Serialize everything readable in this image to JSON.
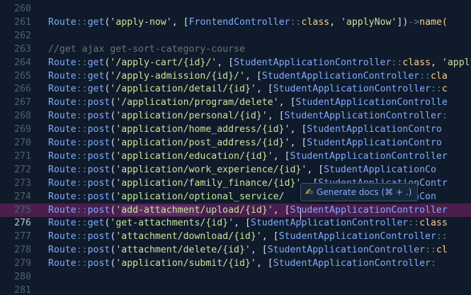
{
  "editor": {
    "lines": [
      {
        "num": "260",
        "tokens": []
      },
      {
        "num": "261",
        "tokens": [
          {
            "t": "Route",
            "c": "t-route"
          },
          {
            "t": "::",
            "c": "t-op"
          },
          {
            "t": "get",
            "c": "t-fn"
          },
          {
            "t": "(",
            "c": "t-brk"
          },
          {
            "t": "'apply-now'",
            "c": "t-str"
          },
          {
            "t": ", ",
            "c": "t-brk"
          },
          {
            "t": "[",
            "c": "t-brk"
          },
          {
            "t": "FrontendController",
            "c": "t-cls"
          },
          {
            "t": "::",
            "c": "t-op"
          },
          {
            "t": "class",
            "c": "t-kw"
          },
          {
            "t": ", ",
            "c": "t-brk"
          },
          {
            "t": "'applyNow'",
            "c": "t-str"
          },
          {
            "t": "])",
            "c": "t-brk"
          },
          {
            "t": "->",
            "c": "t-op"
          },
          {
            "t": "name(",
            "c": "t-kw"
          }
        ]
      },
      {
        "num": "262",
        "tokens": []
      },
      {
        "num": "263",
        "tokens": [
          {
            "t": "//get ajax get-sort-category-course",
            "c": "t-cmt"
          }
        ]
      },
      {
        "num": "264",
        "tokens": [
          {
            "t": "Route",
            "c": "t-route"
          },
          {
            "t": "::",
            "c": "t-op"
          },
          {
            "t": "get",
            "c": "t-fn"
          },
          {
            "t": "(",
            "c": "t-brk"
          },
          {
            "t": "'/apply-cart/{id}/'",
            "c": "t-str"
          },
          {
            "t": ", ",
            "c": "t-brk"
          },
          {
            "t": "[",
            "c": "t-brk"
          },
          {
            "t": "StudentApplicationController",
            "c": "t-cls"
          },
          {
            "t": "::",
            "c": "t-op"
          },
          {
            "t": "class",
            "c": "t-kw"
          },
          {
            "t": ", ",
            "c": "t-brk"
          },
          {
            "t": "'apply",
            "c": "t-str"
          }
        ]
      },
      {
        "num": "265",
        "tokens": [
          {
            "t": "Route",
            "c": "t-route"
          },
          {
            "t": "::",
            "c": "t-op"
          },
          {
            "t": "get",
            "c": "t-fn"
          },
          {
            "t": "(",
            "c": "t-brk"
          },
          {
            "t": "'/apply-admission/{id}/'",
            "c": "t-str"
          },
          {
            "t": ", ",
            "c": "t-brk"
          },
          {
            "t": "[",
            "c": "t-brk"
          },
          {
            "t": "StudentApplicationController",
            "c": "t-cls"
          },
          {
            "t": "::",
            "c": "t-op"
          },
          {
            "t": "cla",
            "c": "t-kw"
          }
        ]
      },
      {
        "num": "266",
        "tokens": [
          {
            "t": "Route",
            "c": "t-route"
          },
          {
            "t": "::",
            "c": "t-op"
          },
          {
            "t": "get",
            "c": "t-fn"
          },
          {
            "t": "(",
            "c": "t-brk"
          },
          {
            "t": "'/application/detail/{id}'",
            "c": "t-str"
          },
          {
            "t": ", ",
            "c": "t-brk"
          },
          {
            "t": "[",
            "c": "t-brk"
          },
          {
            "t": "StudentApplicationController",
            "c": "t-cls"
          },
          {
            "t": "::",
            "c": "t-op"
          },
          {
            "t": "c",
            "c": "t-kw"
          }
        ]
      },
      {
        "num": "267",
        "tokens": [
          {
            "t": "Route",
            "c": "t-route"
          },
          {
            "t": "::",
            "c": "t-op"
          },
          {
            "t": "post",
            "c": "t-fn"
          },
          {
            "t": "(",
            "c": "t-brk"
          },
          {
            "t": "'/application/program/delete'",
            "c": "t-str"
          },
          {
            "t": ", ",
            "c": "t-brk"
          },
          {
            "t": "[",
            "c": "t-brk"
          },
          {
            "t": "StudentApplicationControlle",
            "c": "t-cls"
          }
        ]
      },
      {
        "num": "268",
        "tokens": [
          {
            "t": "Route",
            "c": "t-route"
          },
          {
            "t": "::",
            "c": "t-op"
          },
          {
            "t": "post",
            "c": "t-fn"
          },
          {
            "t": "(",
            "c": "t-brk"
          },
          {
            "t": "'application/personal/{id}'",
            "c": "t-str"
          },
          {
            "t": ", ",
            "c": "t-brk"
          },
          {
            "t": "[",
            "c": "t-brk"
          },
          {
            "t": "StudentApplicationController",
            "c": "t-cls"
          },
          {
            "t": ":",
            "c": "t-op"
          }
        ]
      },
      {
        "num": "269",
        "tokens": [
          {
            "t": "Route",
            "c": "t-route"
          },
          {
            "t": "::",
            "c": "t-op"
          },
          {
            "t": "post",
            "c": "t-fn"
          },
          {
            "t": "(",
            "c": "t-brk"
          },
          {
            "t": "'application/home_address/{id}'",
            "c": "t-str"
          },
          {
            "t": ", ",
            "c": "t-brk"
          },
          {
            "t": "[",
            "c": "t-brk"
          },
          {
            "t": "StudentApplicationContro",
            "c": "t-cls"
          }
        ]
      },
      {
        "num": "270",
        "tokens": [
          {
            "t": "Route",
            "c": "t-route"
          },
          {
            "t": "::",
            "c": "t-op"
          },
          {
            "t": "post",
            "c": "t-fn"
          },
          {
            "t": "(",
            "c": "t-brk"
          },
          {
            "t": "'application/post_address/{id}'",
            "c": "t-str"
          },
          {
            "t": ", ",
            "c": "t-brk"
          },
          {
            "t": "[",
            "c": "t-brk"
          },
          {
            "t": "StudentApplicationContro",
            "c": "t-cls"
          }
        ]
      },
      {
        "num": "271",
        "tokens": [
          {
            "t": "Route",
            "c": "t-route"
          },
          {
            "t": "::",
            "c": "t-op"
          },
          {
            "t": "post",
            "c": "t-fn"
          },
          {
            "t": "(",
            "c": "t-brk"
          },
          {
            "t": "'application/education/{id}'",
            "c": "t-str"
          },
          {
            "t": ", ",
            "c": "t-brk"
          },
          {
            "t": "[",
            "c": "t-brk"
          },
          {
            "t": "StudentApplicationController",
            "c": "t-cls"
          }
        ]
      },
      {
        "num": "272",
        "tokens": [
          {
            "t": "Route",
            "c": "t-route"
          },
          {
            "t": "::",
            "c": "t-op"
          },
          {
            "t": "post",
            "c": "t-fn"
          },
          {
            "t": "(",
            "c": "t-brk"
          },
          {
            "t": "'application/work_experience/{id}'",
            "c": "t-str"
          },
          {
            "t": ", ",
            "c": "t-brk"
          },
          {
            "t": "[",
            "c": "t-brk"
          },
          {
            "t": "StudentApplicationCo",
            "c": "t-cls"
          }
        ]
      },
      {
        "num": "273",
        "tokens": [
          {
            "t": "Route",
            "c": "t-route"
          },
          {
            "t": "::",
            "c": "t-op"
          },
          {
            "t": "post",
            "c": "t-fn"
          },
          {
            "t": "(",
            "c": "t-brk"
          },
          {
            "t": "'application/family_finance/{id}'",
            "c": "t-str"
          },
          {
            "t": ", ",
            "c": "t-brk"
          },
          {
            "t": "[",
            "c": "t-brk"
          },
          {
            "t": "StudentApplicationContr",
            "c": "t-cls"
          }
        ]
      },
      {
        "num": "274",
        "tokens": [
          {
            "t": "Route",
            "c": "t-route"
          },
          {
            "t": "::",
            "c": "t-op"
          },
          {
            "t": "post",
            "c": "t-fn"
          },
          {
            "t": "(",
            "c": "t-brk"
          },
          {
            "t": "'application/optional_service/",
            "c": "t-str"
          },
          {
            "t": "                  ",
            "c": "t-brk"
          },
          {
            "t": "cationCon",
            "c": "t-cls"
          }
        ]
      },
      {
        "num": "275",
        "hl": true,
        "tokens": [
          {
            "t": "Route",
            "c": "t-route"
          },
          {
            "t": "::",
            "c": "t-op"
          },
          {
            "t": "post",
            "c": "t-fn"
          },
          {
            "t": "(",
            "c": "t-brk"
          },
          {
            "t": "'add-attachment/upload/{id}'",
            "c": "t-str"
          },
          {
            "t": ", ",
            "c": "t-brk"
          },
          {
            "t": "[",
            "c": "t-brk"
          },
          {
            "t": "StudentApplicationController",
            "c": "t-cls"
          }
        ]
      },
      {
        "num": "276",
        "current": true,
        "tokens": [
          {
            "t": "Route",
            "c": "t-route"
          },
          {
            "t": "::",
            "c": "t-op"
          },
          {
            "t": "get",
            "c": "t-fn"
          },
          {
            "t": "(",
            "c": "t-brk"
          },
          {
            "t": "'get-attachments/{id}'",
            "c": "t-str"
          },
          {
            "t": ", ",
            "c": "t-brk"
          },
          {
            "t": "[",
            "c": "t-brk"
          },
          {
            "t": "StudentApplicationController",
            "c": "t-cls"
          },
          {
            "t": "::",
            "c": "t-op"
          },
          {
            "t": "class",
            "c": "t-kw"
          }
        ]
      },
      {
        "num": "277",
        "tokens": [
          {
            "t": "Route",
            "c": "t-route"
          },
          {
            "t": "::",
            "c": "t-op"
          },
          {
            "t": "post",
            "c": "t-fn"
          },
          {
            "t": "(",
            "c": "t-brk"
          },
          {
            "t": "'attachment/download/{id}'",
            "c": "t-str"
          },
          {
            "t": ", ",
            "c": "t-brk"
          },
          {
            "t": "[",
            "c": "t-brk"
          },
          {
            "t": "StudentApplicationController",
            "c": "t-cls"
          },
          {
            "t": "::",
            "c": "t-op"
          }
        ]
      },
      {
        "num": "278",
        "tokens": [
          {
            "t": "Route",
            "c": "t-route"
          },
          {
            "t": "::",
            "c": "t-op"
          },
          {
            "t": "post",
            "c": "t-fn"
          },
          {
            "t": "(",
            "c": "t-brk"
          },
          {
            "t": "'attachment/delete/{id}'",
            "c": "t-str"
          },
          {
            "t": ", ",
            "c": "t-brk"
          },
          {
            "t": "[",
            "c": "t-brk"
          },
          {
            "t": "StudentApplicationController",
            "c": "t-cls"
          },
          {
            "t": "::",
            "c": "t-op"
          },
          {
            "t": "cl",
            "c": "t-kw"
          }
        ]
      },
      {
        "num": "279",
        "tokens": [
          {
            "t": "Route",
            "c": "t-route"
          },
          {
            "t": "::",
            "c": "t-op"
          },
          {
            "t": "post",
            "c": "t-fn"
          },
          {
            "t": "(",
            "c": "t-brk"
          },
          {
            "t": "'application/submit/{id}'",
            "c": "t-str"
          },
          {
            "t": ", ",
            "c": "t-brk"
          },
          {
            "t": "[",
            "c": "t-brk"
          },
          {
            "t": "StudentApplicationController",
            "c": "t-cls"
          },
          {
            "t": ":",
            "c": "t-op"
          }
        ]
      },
      {
        "num": "280",
        "tokens": []
      },
      {
        "num": "281",
        "tokens": []
      }
    ],
    "selection_text": "add-attachment"
  },
  "tooltip": {
    "icon": "✍",
    "icon_name": "writing-hand-icon",
    "label": "Generate docs (⌘ + .)"
  }
}
